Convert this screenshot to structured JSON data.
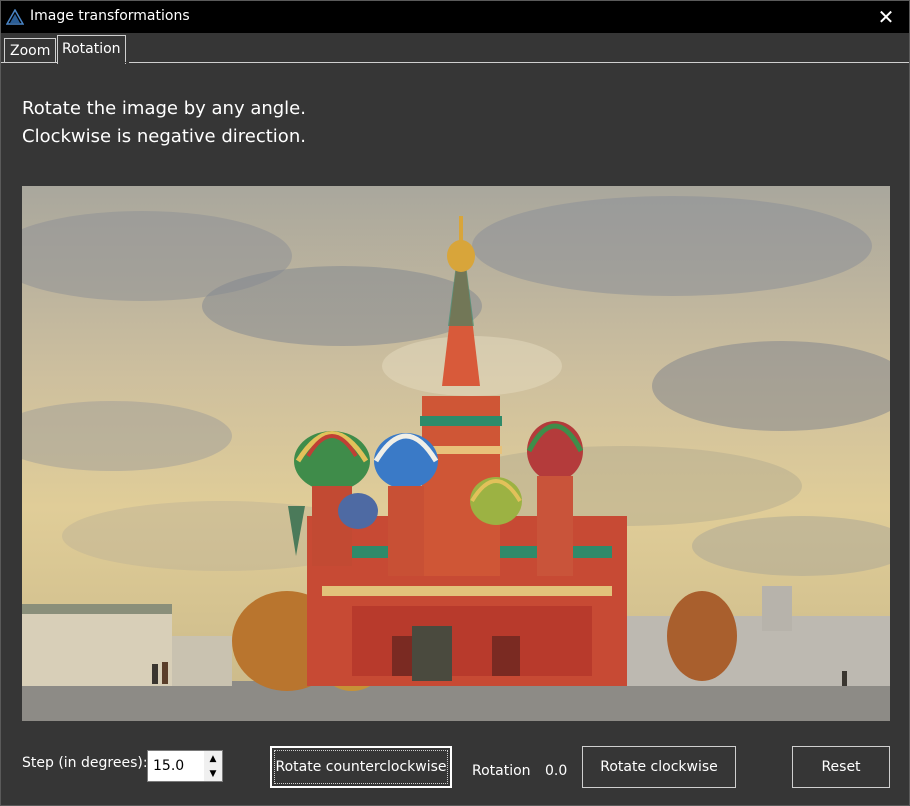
{
  "window": {
    "title": "Image transformations",
    "close_glyph": "✕",
    "icon": "app-triangle-icon"
  },
  "tabs": [
    {
      "label": "Zoom",
      "selected": false
    },
    {
      "label": "Rotation",
      "selected": true
    }
  ],
  "instructions": {
    "line1": "Rotate the image by any angle.",
    "line2": "Clockwise is negative direction."
  },
  "image": {
    "subject": "cathedral-photo"
  },
  "controls": {
    "step_label": "Step (in degrees):",
    "step_value": "15.0",
    "spin_up": "▲",
    "spin_down": "▼",
    "rotate_ccw_label": "Rotate counterclockwise",
    "rotation_label": "Rotation",
    "rotation_value": "0.0",
    "rotate_cw_label": "Rotate clockwise",
    "reset_label": "Reset"
  },
  "colors": {
    "background": "#363636",
    "titlebar": "#000000",
    "text": "#ffffff"
  }
}
